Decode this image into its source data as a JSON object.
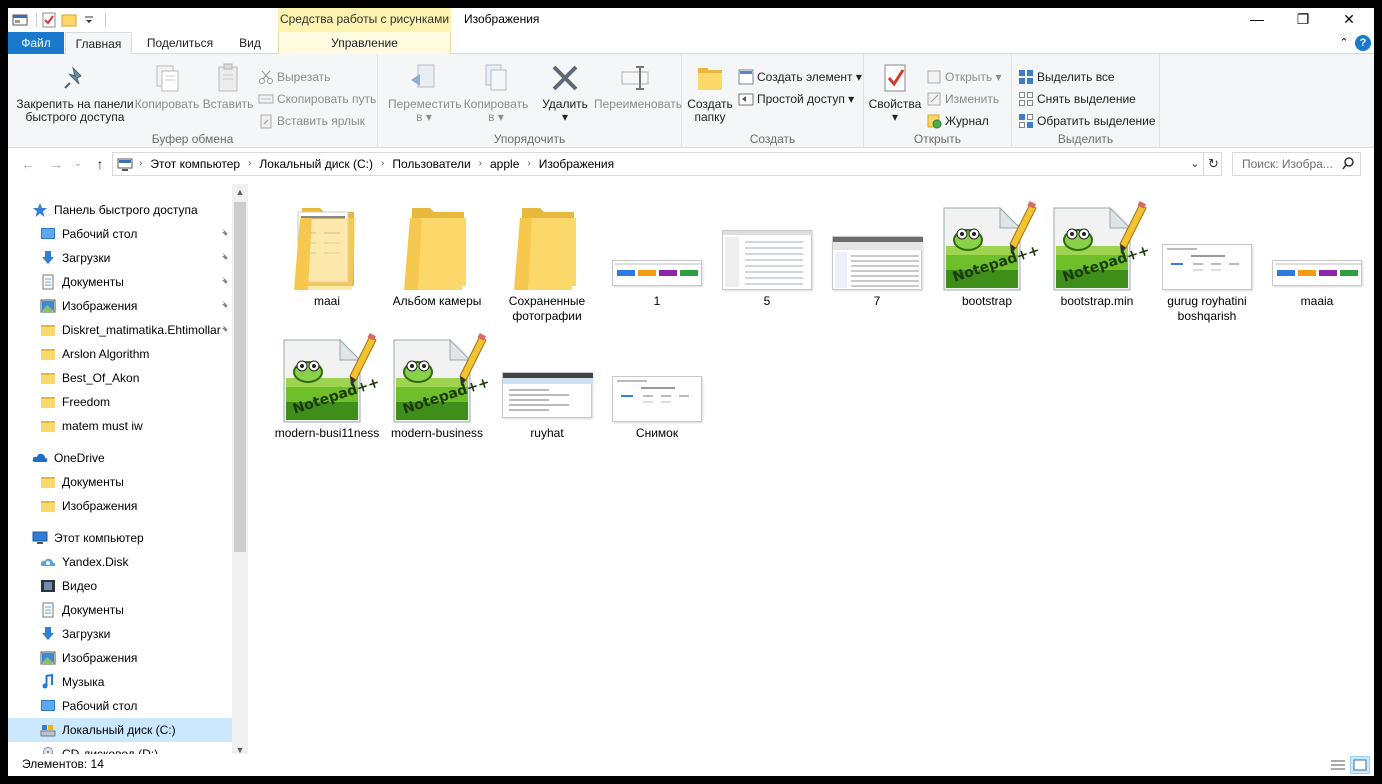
{
  "titlebar": {
    "context_tools": "Средства работы с рисунками",
    "title": "Изображения",
    "minimize": "—",
    "maximize": "❐",
    "close": "✕"
  },
  "tabs": {
    "file": "Файл",
    "home": "Главная",
    "share": "Поделиться",
    "view": "Вид",
    "manage": "Управление",
    "collapse": "⌃",
    "help": "?"
  },
  "ribbon": {
    "clipboard": {
      "label": "Буфер обмена",
      "pin_line1": "Закрепить на панели",
      "pin_line2": "быстрого доступа",
      "copy": "Копировать",
      "paste": "Вставить",
      "cut": "Вырезать",
      "copy_path": "Скопировать путь",
      "paste_shortcut": "Вставить ярлык"
    },
    "organize": {
      "label": "Упорядочить",
      "move_line1": "Переместить",
      "move_line2": "в ▾",
      "copyto_line1": "Копировать",
      "copyto_line2": "в ▾",
      "delete_line1": "Удалить",
      "delete_line2": "▾",
      "rename": "Переименовать"
    },
    "new": {
      "label": "Создать",
      "new_folder_line1": "Создать",
      "new_folder_line2": "папку",
      "new_item": "Создать элемент ▾",
      "easy_access": "Простой доступ ▾"
    },
    "open": {
      "label": "Открыть",
      "properties_line1": "Свойства",
      "properties_line2": "▾",
      "open": "Открыть ▾",
      "edit": "Изменить",
      "history": "Журнал"
    },
    "select": {
      "label": "Выделить",
      "select_all": "Выделить все",
      "select_none": "Снять выделение",
      "invert": "Обратить выделение"
    }
  },
  "address": {
    "crumbs": [
      "Этот компьютер",
      "Локальный диск (C:)",
      "Пользователи",
      "apple",
      "Изображения"
    ],
    "search_placeholder": "Поиск: Изобра..."
  },
  "navpane": {
    "quick_access": "Панель быстрого доступа",
    "quick_items": [
      {
        "label": "Рабочий стол",
        "icon": "desktop-icon",
        "pinned": true
      },
      {
        "label": "Загрузки",
        "icon": "downloads-icon",
        "pinned": true
      },
      {
        "label": "Документы",
        "icon": "documents-icon",
        "pinned": true
      },
      {
        "label": "Изображения",
        "icon": "pictures-icon",
        "pinned": true
      },
      {
        "label": "Diskret_matimatika.Ehtimollar",
        "icon": "folder-icon",
        "pinned": true
      },
      {
        "label": "Arslon Algorithm",
        "icon": "folder-icon",
        "pinned": false
      },
      {
        "label": "Best_Of_Akon",
        "icon": "folder-icon",
        "pinned": false
      },
      {
        "label": "Freedom",
        "icon": "folder-icon",
        "pinned": false
      },
      {
        "label": "matem must iw",
        "icon": "folder-icon",
        "pinned": false
      }
    ],
    "onedrive": "OneDrive",
    "onedrive_items": [
      {
        "label": "Документы",
        "icon": "folder-icon"
      },
      {
        "label": "Изображения",
        "icon": "folder-icon"
      }
    ],
    "this_pc": "Этот компьютер",
    "pc_items": [
      {
        "label": "Yandex.Disk",
        "icon": "yandex-disk-icon"
      },
      {
        "label": "Видео",
        "icon": "videos-icon"
      },
      {
        "label": "Документы",
        "icon": "documents-icon"
      },
      {
        "label": "Загрузки",
        "icon": "downloads-icon"
      },
      {
        "label": "Изображения",
        "icon": "pictures-icon"
      },
      {
        "label": "Музыка",
        "icon": "music-icon"
      },
      {
        "label": "Рабочий стол",
        "icon": "desktop-icon"
      },
      {
        "label": "Локальный диск (C:)",
        "icon": "drive-icon",
        "selected": true
      },
      {
        "label": "CD-дисковод (D:)",
        "icon": "cd-drive-icon"
      }
    ]
  },
  "files": [
    {
      "name": "maai",
      "kind": "folder-doc"
    },
    {
      "name": "Альбом камеры",
      "kind": "folder"
    },
    {
      "name": "Сохраненные фотографии",
      "kind": "folder"
    },
    {
      "name": "1",
      "kind": "shot-buttons"
    },
    {
      "name": "5",
      "kind": "shot-form"
    },
    {
      "name": "7",
      "kind": "shot-table"
    },
    {
      "name": "bootstrap",
      "kind": "notepad"
    },
    {
      "name": "bootstrap.min",
      "kind": "notepad"
    },
    {
      "name": "gurug royhatini boshqarish",
      "kind": "shot-page"
    },
    {
      "name": "maaia",
      "kind": "shot-buttons"
    },
    {
      "name": "modern-busi11ness",
      "kind": "notepad"
    },
    {
      "name": "modern-business",
      "kind": "notepad"
    },
    {
      "name": "ruyhat",
      "kind": "shot-window"
    },
    {
      "name": "Снимок",
      "kind": "shot-page"
    }
  ],
  "status": {
    "count": "Элементов: 14"
  },
  "colors": {
    "file_tab": "#1979ca",
    "context_tab": "#fcf3b0",
    "selection": "#cce8ff",
    "folder": "#fcd76a"
  }
}
